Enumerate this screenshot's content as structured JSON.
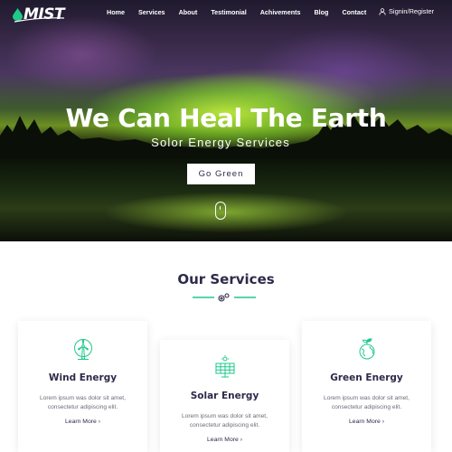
{
  "brand": {
    "name": "MIST"
  },
  "nav": {
    "items": [
      "Home",
      "Services",
      "About",
      "Testimonial",
      "Achivements",
      "Blog",
      "Contact"
    ],
    "signin_label": "Signin/Register"
  },
  "hero": {
    "title": "We Can Heal The Earth",
    "subtitle": "Solor Energy Services",
    "button_label": "Go Green"
  },
  "services": {
    "title": "Our Services",
    "cards": [
      {
        "icon": "wind-turbine-icon",
        "title": "Wind Energy",
        "text_line1": "Lorem ipsum was dolor sit amet,",
        "text_line2": "consectetur adipiscing elit.",
        "link": "Learn More"
      },
      {
        "icon": "solar-panel-icon",
        "title": "Solar Energy",
        "text_line1": "Lorem ipsum was dolor sit amet,",
        "text_line2": "consectetur adipiscing elit.",
        "link": "Learn More"
      },
      {
        "icon": "green-earth-icon",
        "title": "Green Energy",
        "text_line1": "Lorem ipsum was dolor sit amet,",
        "text_line2": "consectetur adipiscing elit.",
        "link": "Learn More"
      }
    ]
  },
  "colors": {
    "accent": "#1ec98a",
    "heading": "#2d2a4a",
    "body_text": "#6b6b78"
  }
}
